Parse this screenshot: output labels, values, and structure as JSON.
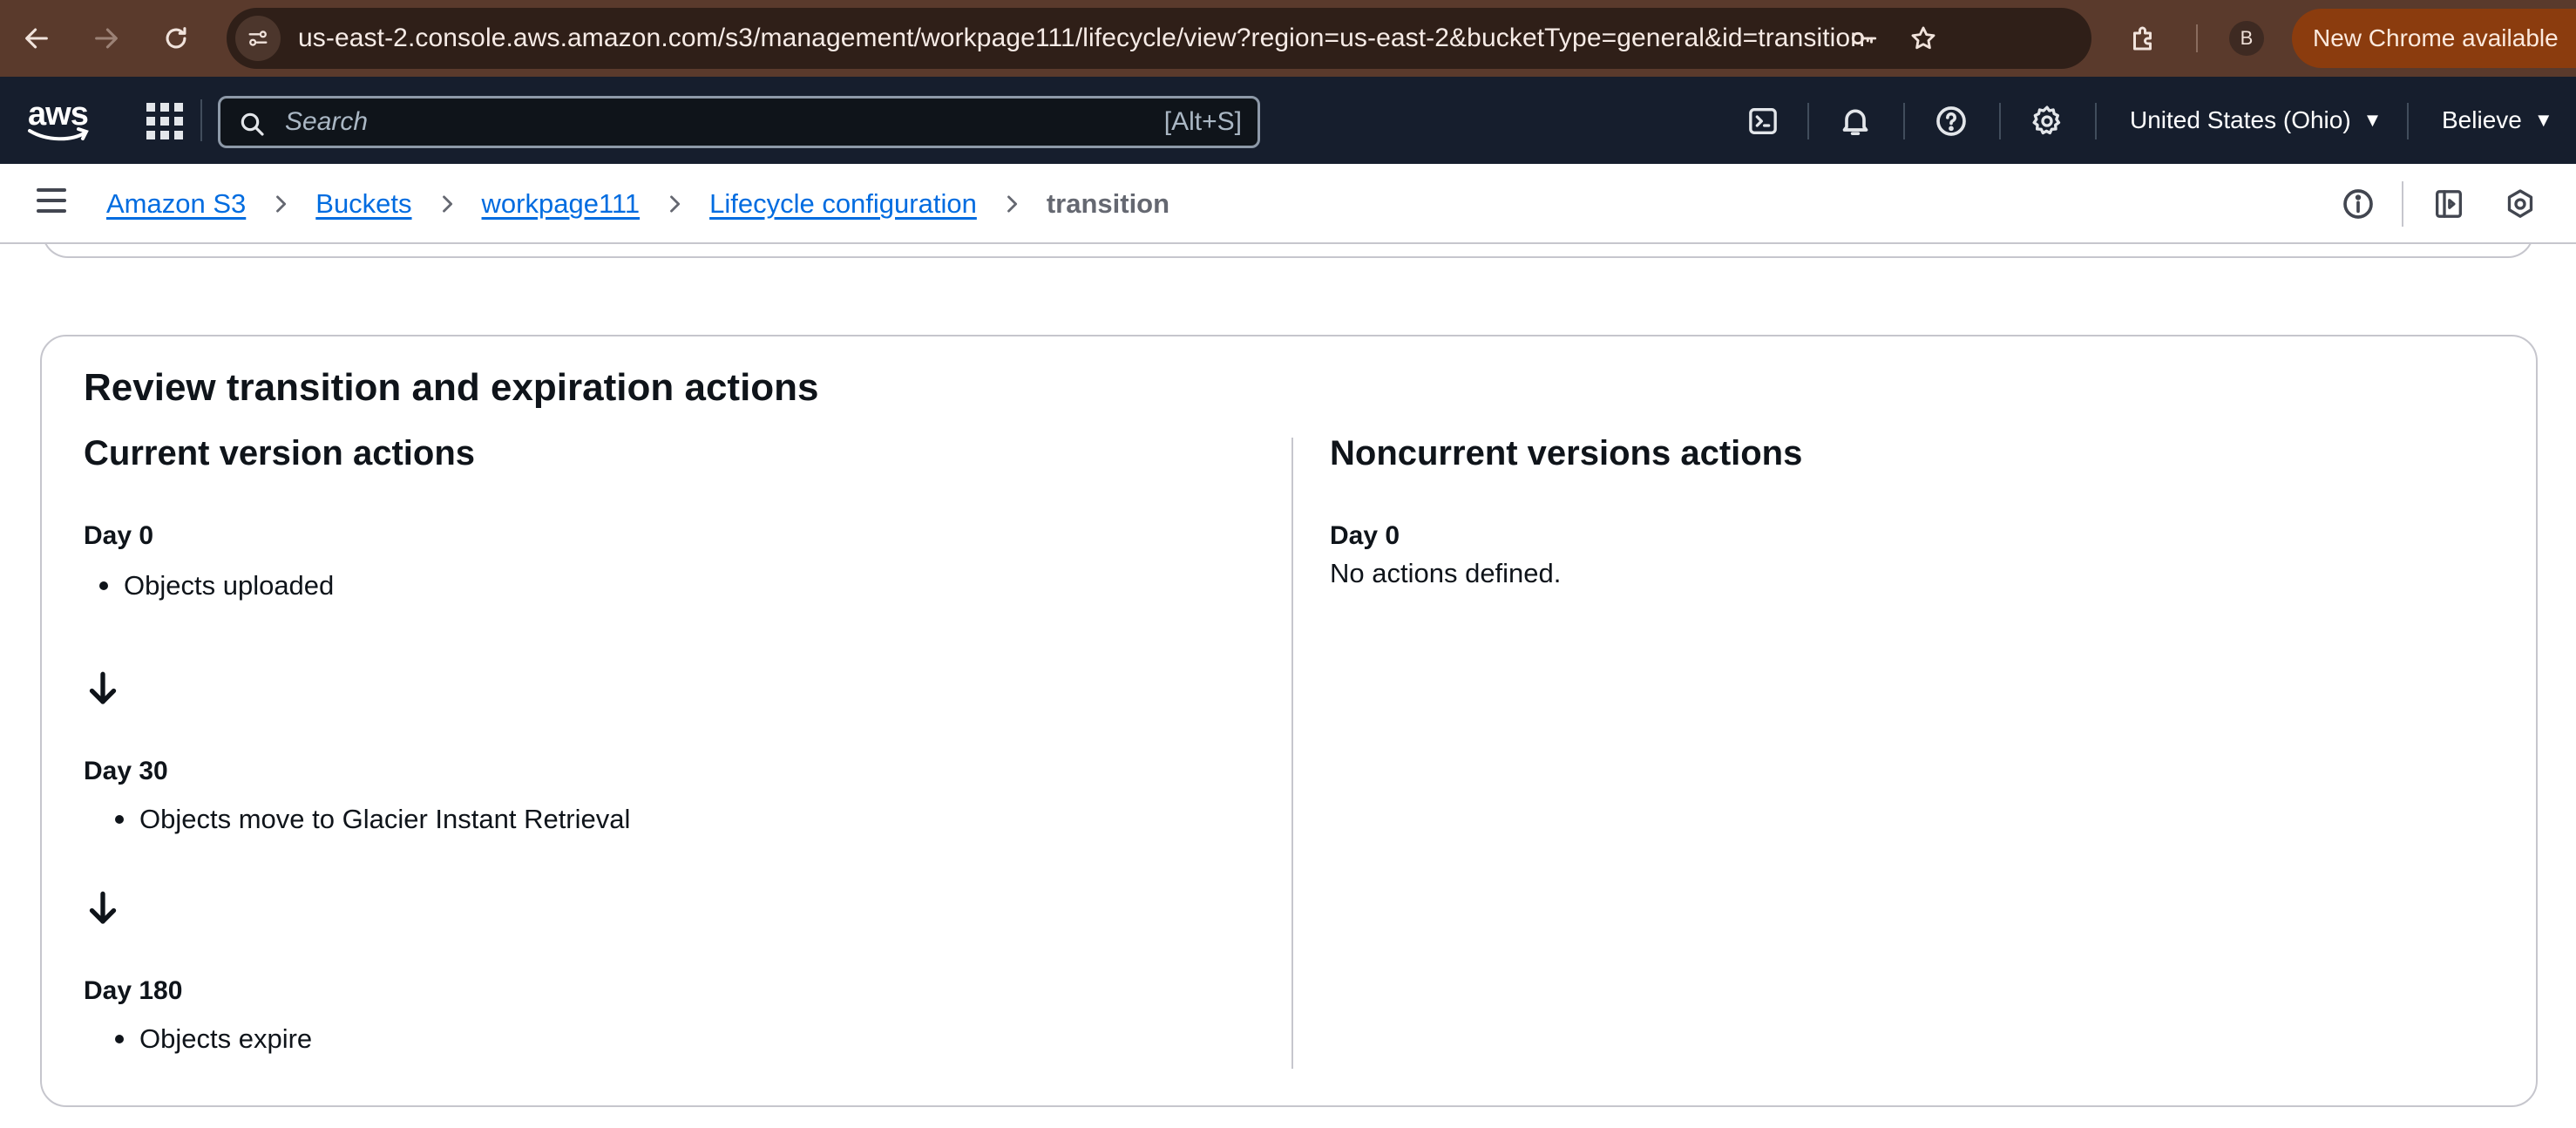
{
  "browser": {
    "url": "us-east-2.console.aws.amazon.com/s3/management/workpage111/lifecycle/view?region=us-east-2&bucketType=general&id=transition",
    "profile_initial": "B",
    "update_label": "New Chrome available",
    "icons": [
      "back-icon",
      "forward-icon",
      "reload-icon",
      "site-info-icon",
      "password-key-icon",
      "bookmark-star-icon",
      "extensions-icon"
    ]
  },
  "aws_header": {
    "logo_text": "aws",
    "search_placeholder": "Search",
    "search_shortcut": "[Alt+S]",
    "region": "United States (Ohio)",
    "user": "Believe",
    "icons": [
      "apps-grid-icon",
      "cloudshell-icon",
      "notifications-bell-icon",
      "help-icon",
      "settings-gear-icon"
    ]
  },
  "breadcrumb": {
    "items": [
      {
        "label": "Amazon S3"
      },
      {
        "label": "Buckets"
      },
      {
        "label": "workpage111"
      },
      {
        "label": "Lifecycle configuration"
      }
    ],
    "current": "transition"
  },
  "review": {
    "title": "Review transition and expiration actions",
    "current": {
      "title": "Current version actions",
      "steps": [
        {
          "day": "Day 0",
          "action": "Objects uploaded"
        },
        {
          "day": "Day 30",
          "action": "Objects move to Glacier Instant Retrieval"
        },
        {
          "day": "Day 180",
          "action": "Objects expire"
        }
      ]
    },
    "noncurrent": {
      "title": "Noncurrent versions actions",
      "day": "Day 0",
      "message": "No actions defined."
    }
  },
  "colors": {
    "chrome_bar": "#5a3a2c",
    "aws_header": "#161e2d",
    "link": "#006ce0",
    "update_pill": "#8b3c0e"
  }
}
